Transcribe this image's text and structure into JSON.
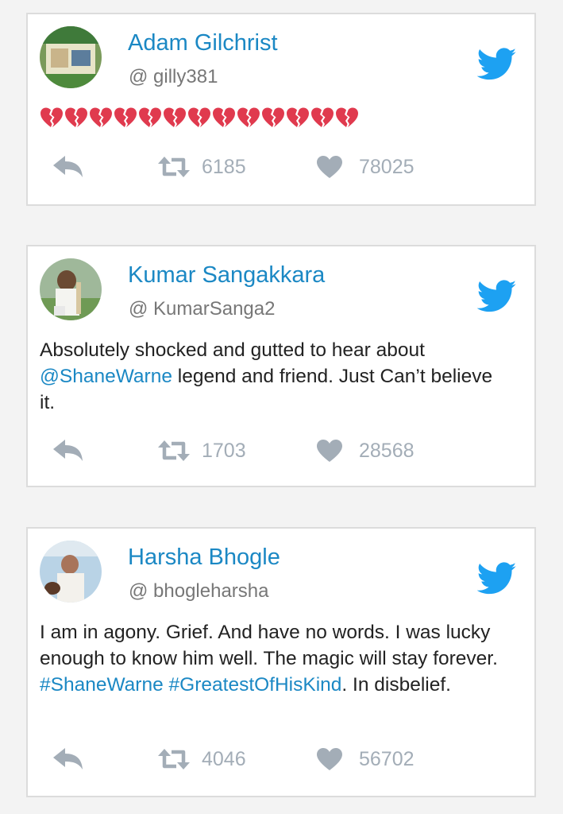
{
  "colors": {
    "name": "#1b88c4",
    "link": "#1b88c4",
    "handle": "#777777",
    "icon": "#a3adb7",
    "twitter_bird": "#1da1f2",
    "broken_heart": "#e03a4e"
  },
  "icons": {
    "brand": "twitter-bird-icon",
    "reply": "reply-arrow-icon",
    "retweet": "retweet-icon",
    "like": "heart-icon"
  },
  "tweets": [
    {
      "name": "Adam Gilchrist",
      "handle": "@ gilly381",
      "emoji_text": "💔💔💔💔💔💔💔💔💔💔💔💔💔",
      "emoji_count": 13,
      "retweets": "6185",
      "likes": "78025"
    },
    {
      "name": "Kumar Sangakkara",
      "handle": "@ KumarSanga2",
      "text_1": "Absolutely shocked and gutted to hear about ",
      "mention": "@ShaneWarne",
      "text_2": " legend and friend. Just Can’t believe it.",
      "retweets": "1703",
      "likes": "28568"
    },
    {
      "name": "Harsha Bhogle",
      "handle": "@ bhogleharsha",
      "text_1": "I am in agony. Grief. And have no words. I was lucky enough to know him well. The magic will stay forever. ",
      "hashtag_1": "#ShaneWarne",
      "text_2": " ",
      "hashtag_2": "#GreatestOfHisKind",
      "text_3": ". In disbelief.",
      "retweets": "4046",
      "likes": "56702"
    }
  ]
}
